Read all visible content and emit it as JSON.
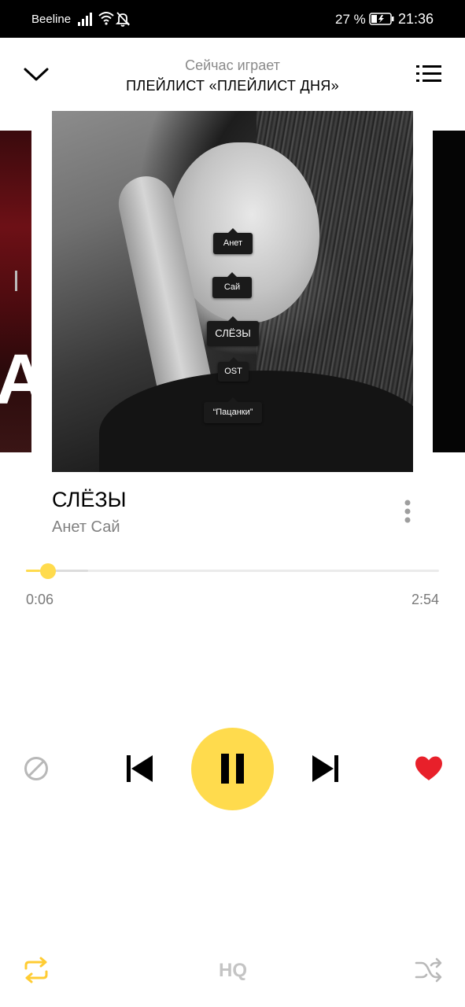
{
  "status_bar": {
    "carrier": "Beeline",
    "battery_percent": "27 %",
    "time": "21:36",
    "icons": [
      "signal-icon",
      "wifi-icon",
      "notifications-muted-icon",
      "battery-charging-icon"
    ]
  },
  "header": {
    "subtitle": "Сейчас играет",
    "title": "ПЛЕЙЛИСТ «ПЛЕЙЛИСТ ДНЯ»",
    "collapse_icon": "chevron-down-icon",
    "queue_icon": "queue-list-icon"
  },
  "cover": {
    "tags": [
      "Анет",
      "Сай",
      "СЛЁЗЫ",
      "OST",
      "“Пацанки”"
    ]
  },
  "track": {
    "title": "СЛЁЗЫ",
    "artist": "Анет Сай"
  },
  "progress": {
    "elapsed": "0:06",
    "total": "2:54",
    "played_fraction": 0.034,
    "buffered_fraction": 0.15
  },
  "controls": {
    "dislike_icon": "dislike-icon",
    "previous_icon": "skip-previous-icon",
    "play_pause_icon": "pause-icon",
    "next_icon": "skip-next-icon",
    "like_icon": "heart-icon"
  },
  "bottom": {
    "repeat_icon": "repeat-icon",
    "quality_label": "HQ",
    "shuffle_icon": "shuffle-icon"
  },
  "colors": {
    "accent": "#ffdb4d",
    "like": "#e8202a",
    "muted_text": "#808080"
  }
}
